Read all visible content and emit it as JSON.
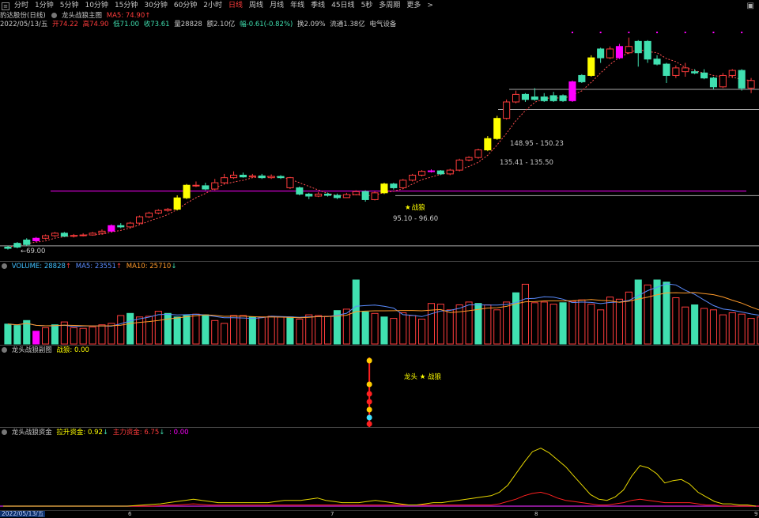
{
  "toolbar": {
    "periods": [
      "分时",
      "1分钟",
      "5分钟",
      "10分钟",
      "15分钟",
      "30分钟",
      "60分钟",
      "2小时",
      "日线",
      "周线",
      "月线",
      "年线",
      "季线",
      "45日线",
      "5秒",
      "多周期",
      "更多"
    ],
    "active_period": "日线",
    "more_arrow": ">"
  },
  "title_row": {
    "stock_name": "豹达股份(日线)",
    "indicator_name": "龙头战狼主图",
    "ma_label": "MA5: 74.90",
    "ma_arrow": "↑"
  },
  "info_row": {
    "date": "2022/05/13/五",
    "open": "开74.22",
    "high": "高74.90",
    "low": "低71.00",
    "close": "收73.61",
    "volume": "量28828",
    "amount": "额2.10亿",
    "change": "幅-0.61(-0.82%)",
    "turnover": "换2.09%",
    "float": "流通1.38亿",
    "sector": "电气设备"
  },
  "price_annotations": {
    "low_label": "69.00",
    "zone1": "95.10 - 96.60",
    "zone2": "135.41 - 135.50",
    "zone3": "148.95 - 150.23",
    "battle_tag": "战狼"
  },
  "volume_panel": {
    "volume_label": "VOLUME: 28828",
    "volume_arrow": "↑",
    "ma5_label": "MA5: 23551",
    "ma5_arrow": "↑",
    "ma10_label": "MA10: 25710",
    "ma10_arrow": "↓"
  },
  "sub1_panel": {
    "title": "龙头战狼副图",
    "value": "战狼: 0.00",
    "signal_label": "龙头 ★ 战狼"
  },
  "sub2_panel": {
    "title": "龙头战狼资金",
    "lift_label": "拉升资金: 0.92",
    "lift_arrow": "↓",
    "main_label": "主力资金: 6.75",
    "main_arrow": "↓",
    "extra_label": ": 0.00"
  },
  "x_axis": {
    "date_box": "2022/05/13/五",
    "ticks": [
      "6",
      "7",
      "8",
      "9"
    ]
  },
  "colors": {
    "up": "#ff3c3c",
    "down": "#40e0b0",
    "yellow": "#ffff00",
    "magenta": "#ff00ff",
    "ma5": "#5a8cff",
    "ma10": "#ff9a2a"
  },
  "chart_data": {
    "type": "candlestick",
    "candles": [
      [
        68.5,
        69.0,
        69.5,
        68.0,
        "d"
      ],
      [
        69.0,
        70.5,
        71.0,
        68.5,
        "d"
      ],
      [
        70.0,
        71.8,
        72.5,
        69.5,
        "d"
      ],
      [
        71.5,
        72.5,
        73.0,
        71.0,
        "m"
      ],
      [
        72.5,
        73.5,
        74.0,
        72.0,
        "u"
      ],
      [
        73.5,
        74.5,
        75.0,
        73.0,
        "u"
      ],
      [
        74.5,
        73.3,
        75.0,
        73.0,
        "d"
      ],
      [
        73.3,
        73.6,
        74.2,
        72.8,
        "u"
      ],
      [
        73.6,
        73.8,
        74.5,
        73.2,
        "u"
      ],
      [
        73.8,
        74.5,
        75.0,
        73.5,
        "u"
      ],
      [
        74.5,
        75.3,
        76.0,
        74.0,
        "u"
      ],
      [
        75.3,
        77.5,
        78.0,
        75.0,
        "m"
      ],
      [
        77.5,
        77.0,
        78.5,
        76.5,
        "d"
      ],
      [
        77.0,
        78.5,
        79.0,
        76.5,
        "u"
      ],
      [
        78.5,
        81.0,
        81.5,
        78.0,
        "u"
      ],
      [
        81.0,
        82.5,
        83.0,
        80.5,
        "u"
      ],
      [
        82.5,
        83.5,
        84.0,
        82.0,
        "u"
      ],
      [
        83.5,
        84.0,
        84.5,
        83.0,
        "u"
      ],
      [
        84.0,
        88.5,
        89.5,
        83.5,
        "y"
      ],
      [
        88.5,
        93.5,
        94.0,
        88.0,
        "y"
      ],
      [
        93.5,
        93.3,
        95.0,
        92.8,
        "u"
      ],
      [
        93.3,
        92.0,
        94.5,
        91.5,
        "d"
      ],
      [
        92.0,
        94.5,
        96.0,
        91.5,
        "u"
      ],
      [
        94.5,
        96.5,
        98.0,
        94.0,
        "u"
      ],
      [
        96.5,
        97.5,
        99.0,
        96.0,
        "u"
      ],
      [
        97.5,
        96.8,
        98.5,
        96.5,
        "d"
      ],
      [
        96.8,
        97.2,
        98.0,
        96.5,
        "u"
      ],
      [
        97.2,
        96.5,
        98.0,
        96.0,
        "d"
      ],
      [
        96.5,
        97.0,
        97.8,
        96.0,
        "u"
      ],
      [
        97.0,
        96.5,
        97.5,
        96.0,
        "d"
      ],
      [
        96.5,
        92.5,
        96.8,
        92.0,
        "u"
      ],
      [
        92.5,
        90.0,
        93.0,
        89.5,
        "d"
      ],
      [
        90.0,
        89.2,
        90.5,
        88.0,
        "d"
      ],
      [
        89.2,
        90.0,
        90.8,
        88.8,
        "u"
      ],
      [
        90.0,
        89.5,
        90.6,
        89.0,
        "d"
      ],
      [
        89.5,
        88.6,
        90.2,
        88.0,
        "d"
      ],
      [
        88.6,
        89.8,
        90.5,
        88.5,
        "u"
      ],
      [
        89.8,
        91.0,
        91.5,
        89.5,
        "u"
      ],
      [
        91.0,
        87.8,
        91.5,
        87.0,
        "d"
      ],
      [
        87.8,
        90.5,
        91.0,
        87.5,
        "u"
      ],
      [
        90.5,
        94.0,
        94.5,
        90.0,
        "y"
      ],
      [
        94.0,
        92.5,
        94.5,
        91.8,
        "d"
      ],
      [
        92.5,
        95.5,
        96.0,
        92.0,
        "u"
      ],
      [
        95.5,
        97.5,
        98.0,
        95.0,
        "u"
      ],
      [
        97.5,
        99.0,
        99.5,
        97.0,
        "u"
      ],
      [
        99.0,
        99.2,
        99.8,
        98.5,
        "m"
      ],
      [
        99.2,
        98.0,
        99.5,
        97.5,
        "d"
      ],
      [
        98.0,
        99.5,
        100.0,
        97.5,
        "u"
      ],
      [
        99.5,
        103.5,
        104.0,
        99.0,
        "u"
      ],
      [
        103.5,
        104.5,
        105.0,
        103.0,
        "u"
      ],
      [
        104.5,
        107.5,
        108.0,
        104.0,
        "u"
      ],
      [
        107.5,
        112.0,
        113.0,
        107.0,
        "y"
      ],
      [
        112.0,
        120.0,
        121.0,
        111.5,
        "y"
      ],
      [
        120.0,
        126.5,
        127.5,
        119.5,
        "u"
      ],
      [
        126.5,
        129.5,
        131.0,
        126.0,
        "u"
      ],
      [
        129.5,
        127.5,
        130.0,
        126.5,
        "d"
      ],
      [
        127.5,
        128.5,
        132.0,
        127.0,
        "d"
      ],
      [
        128.5,
        127.0,
        130.0,
        126.5,
        "d"
      ],
      [
        127.0,
        129.0,
        130.5,
        126.5,
        "d"
      ],
      [
        129.0,
        127.0,
        129.5,
        126.5,
        "d"
      ],
      [
        127.0,
        134.5,
        135.0,
        126.5,
        "m"
      ],
      [
        134.5,
        137.0,
        137.5,
        134.0,
        "d"
      ],
      [
        137.0,
        144.0,
        145.0,
        136.5,
        "y"
      ],
      [
        144.0,
        147.5,
        148.0,
        142.0,
        "d"
      ],
      [
        147.5,
        144.0,
        148.5,
        143.5,
        "u"
      ],
      [
        144.0,
        148.5,
        149.5,
        143.5,
        "m"
      ],
      [
        148.5,
        146.0,
        152.0,
        145.5,
        "u"
      ],
      [
        146.0,
        150.5,
        151.0,
        140.5,
        "d"
      ],
      [
        150.5,
        143.5,
        151.0,
        142.0,
        "d"
      ],
      [
        143.5,
        141.5,
        145.0,
        141.0,
        "d"
      ],
      [
        141.5,
        137.0,
        142.0,
        134.0,
        "d"
      ],
      [
        137.0,
        140.0,
        141.0,
        136.0,
        "u"
      ],
      [
        140.0,
        138.5,
        142.0,
        136.5,
        "u"
      ],
      [
        138.5,
        138.0,
        139.5,
        137.5,
        "d"
      ],
      [
        138.0,
        136.0,
        139.5,
        135.5,
        "d"
      ],
      [
        136.0,
        132.5,
        136.5,
        131.5,
        "d"
      ],
      [
        132.5,
        137.0,
        138.0,
        132.0,
        "u"
      ],
      [
        137.0,
        139.0,
        139.5,
        136.0,
        "u"
      ],
      [
        139.0,
        132.0,
        139.5,
        131.0,
        "d"
      ],
      [
        132.0,
        135.0,
        136.0,
        130.0,
        "u"
      ]
    ],
    "price_range": [
      66,
      155
    ],
    "volumes": [
      [
        28,
        "d"
      ],
      [
        26,
        "d"
      ],
      [
        33,
        "d"
      ],
      [
        18,
        "m"
      ],
      [
        23,
        "u"
      ],
      [
        27,
        "d"
      ],
      [
        31,
        "u"
      ],
      [
        23,
        "u"
      ],
      [
        22,
        "u"
      ],
      [
        24,
        "u"
      ],
      [
        27,
        "u"
      ],
      [
        29,
        "u"
      ],
      [
        40,
        "u"
      ],
      [
        43,
        "d"
      ],
      [
        38,
        "u"
      ],
      [
        39,
        "u"
      ],
      [
        46,
        "u"
      ],
      [
        43,
        "d"
      ],
      [
        38,
        "d"
      ],
      [
        40,
        "d"
      ],
      [
        42,
        "u"
      ],
      [
        41,
        "d"
      ],
      [
        33,
        "u"
      ],
      [
        29,
        "u"
      ],
      [
        40,
        "u"
      ],
      [
        40,
        "u"
      ],
      [
        38,
        "d"
      ],
      [
        38,
        "u"
      ],
      [
        39,
        "u"
      ],
      [
        38,
        "u"
      ],
      [
        38,
        "d"
      ],
      [
        35,
        "u"
      ],
      [
        41,
        "u"
      ],
      [
        40,
        "u"
      ],
      [
        39,
        "u"
      ],
      [
        47,
        "d"
      ],
      [
        49,
        "u"
      ],
      [
        90,
        "d"
      ],
      [
        45,
        "d"
      ],
      [
        43,
        "u"
      ],
      [
        38,
        "d"
      ],
      [
        36,
        "u"
      ],
      [
        44,
        "u"
      ],
      [
        40,
        "u"
      ],
      [
        35,
        "u"
      ],
      [
        57,
        "u"
      ],
      [
        56,
        "u"
      ],
      [
        48,
        "u"
      ],
      [
        55,
        "u"
      ],
      [
        59,
        "u"
      ],
      [
        57,
        "d"
      ],
      [
        55,
        "u"
      ],
      [
        48,
        "u"
      ],
      [
        59,
        "u"
      ],
      [
        72,
        "d"
      ],
      [
        84,
        "u"
      ],
      [
        58,
        "u"
      ],
      [
        59,
        "u"
      ],
      [
        56,
        "u"
      ],
      [
        58,
        "d"
      ],
      [
        60,
        "u"
      ],
      [
        62,
        "u"
      ],
      [
        56,
        "u"
      ],
      [
        48,
        "u"
      ],
      [
        66,
        "u"
      ],
      [
        63,
        "u"
      ],
      [
        73,
        "u"
      ],
      [
        90,
        "d"
      ],
      [
        83,
        "u"
      ],
      [
        90,
        "d"
      ],
      [
        87,
        "d"
      ],
      [
        65,
        "u"
      ],
      [
        52,
        "u"
      ],
      [
        55,
        "d"
      ],
      [
        50,
        "u"
      ],
      [
        48,
        "u"
      ],
      [
        41,
        "u"
      ],
      [
        44,
        "u"
      ],
      [
        42,
        "u"
      ],
      [
        36,
        "u"
      ],
      [
        38,
        "u"
      ],
      [
        39,
        "d"
      ],
      [
        30,
        "u"
      ]
    ],
    "volume_max": 100,
    "lift_series": [
      0,
      0,
      0,
      0,
      0,
      0,
      0,
      0,
      0,
      0,
      0,
      0,
      0,
      0,
      0,
      0,
      0.5,
      1,
      1.5,
      2,
      3,
      4,
      5,
      6,
      5,
      4,
      3,
      3,
      3,
      3,
      3,
      3,
      3,
      4,
      5,
      5,
      5,
      6,
      7,
      5,
      4,
      3,
      3,
      3,
      4,
      5,
      4,
      3,
      2,
      1,
      1,
      2,
      3,
      3,
      4,
      5,
      6,
      7,
      8,
      9,
      12,
      18,
      28,
      38,
      47,
      50,
      46,
      40,
      34,
      26,
      18,
      10,
      6,
      5,
      8,
      14,
      26,
      35,
      33,
      28,
      20,
      22,
      23,
      19,
      12,
      8,
      4,
      2,
      2,
      1,
      1,
      0
    ],
    "main_series": [
      0,
      0,
      0,
      0,
      0,
      0,
      0,
      0,
      0,
      0,
      0,
      0,
      0,
      0,
      0,
      0,
      0,
      0,
      0,
      0.5,
      1,
      1,
      1.5,
      2,
      1.5,
      1,
      1,
      1,
      1,
      1,
      1,
      1,
      1,
      1,
      1,
      1,
      1,
      1,
      1,
      1,
      1,
      1,
      1,
      1,
      1,
      1,
      1,
      1,
      1,
      1,
      1,
      1,
      1,
      1,
      1,
      1,
      1,
      1,
      1,
      1,
      2,
      4,
      6,
      9,
      11,
      12,
      10,
      7,
      5,
      4,
      3,
      2,
      1,
      1,
      2,
      3,
      5,
      6,
      5,
      4,
      3,
      3,
      3,
      3,
      2,
      1,
      1,
      0,
      0,
      0,
      0,
      0,
      0
    ],
    "series_max": 60
  }
}
